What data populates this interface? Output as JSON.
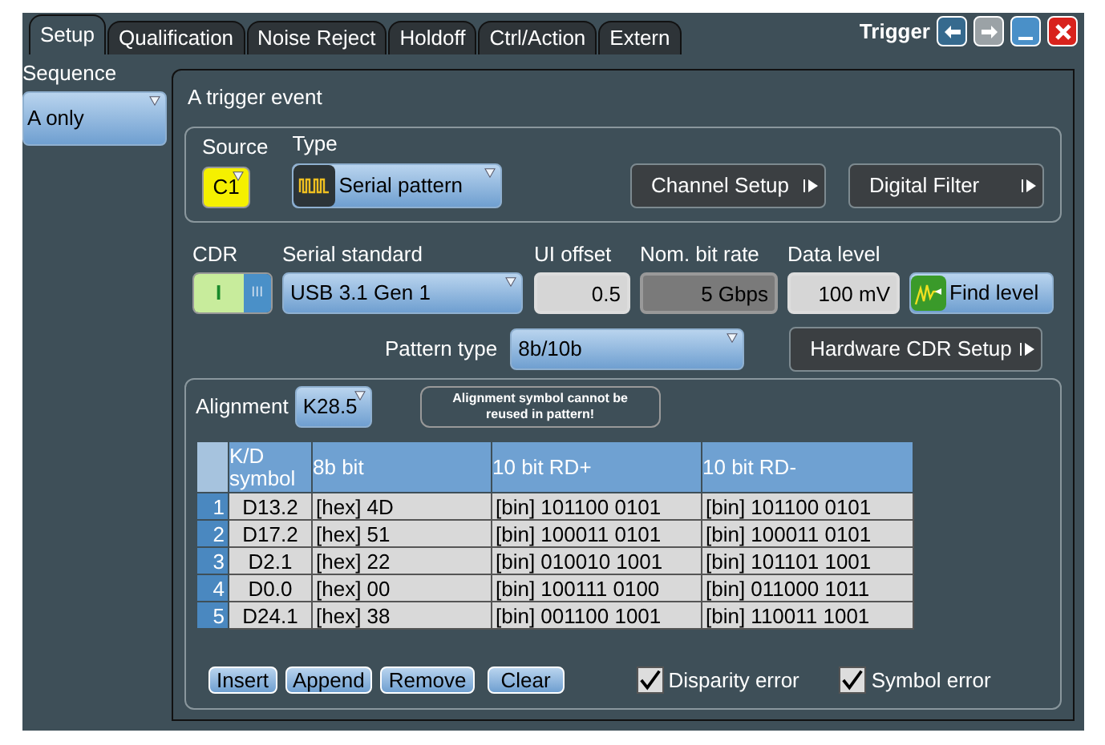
{
  "tabs": [
    {
      "label": "Setup",
      "selected": true
    },
    {
      "label": "Qualification",
      "selected": false
    },
    {
      "label": "Noise Reject",
      "selected": false
    },
    {
      "label": "Holdoff",
      "selected": false
    },
    {
      "label": "Ctrl/Action",
      "selected": false
    },
    {
      "label": "Extern",
      "selected": false
    }
  ],
  "window": {
    "title": "Trigger"
  },
  "sequence": {
    "label": "Sequence",
    "value": "A only"
  },
  "event": {
    "title": "A trigger event",
    "source_label": "Source",
    "source": "C1",
    "type_label": "Type",
    "type": "Serial pattern",
    "channel_setup": "Channel Setup",
    "digital_filter": "Digital Filter"
  },
  "cdr": {
    "label": "CDR",
    "on": true,
    "on_text": "I",
    "off_text": "III"
  },
  "serial_standard": {
    "label": "Serial standard",
    "value": "USB 3.1 Gen 1"
  },
  "ui_offset": {
    "label": "UI offset",
    "value": "0.5"
  },
  "bit_rate": {
    "label": "Nom. bit rate",
    "value": "5 Gbps",
    "disabled": true
  },
  "data_level": {
    "label": "Data level",
    "value": "100 mV"
  },
  "find_level": "Find level",
  "pattern_type": {
    "label": "Pattern type",
    "value": "8b/10b"
  },
  "hardware_cdr": "Hardware CDR Setup",
  "alignment": {
    "label": "Alignment",
    "value": "K28.5",
    "note": "Alignment symbol cannot be reused in pattern!"
  },
  "table": {
    "columns": [
      "K/D symbol",
      "8b bit",
      "10 bit RD+",
      "10 bit RD-"
    ],
    "rows": [
      {
        "index": "1",
        "cells": [
          "D13.2",
          "[hex] 4D",
          "[bin] 101100 0101",
          "[bin] 101100 0101"
        ]
      },
      {
        "index": "2",
        "cells": [
          "D17.2",
          "[hex] 51",
          "[bin] 100011 0101",
          "[bin] 100011 0101"
        ]
      },
      {
        "index": "3",
        "cells": [
          "D2.1",
          "[hex] 22",
          "[bin] 010010 1001",
          "[bin] 101101 1001"
        ]
      },
      {
        "index": "4",
        "cells": [
          "D0.0",
          "[hex] 00",
          "[bin] 100111 0100",
          "[bin] 011000 1011"
        ]
      },
      {
        "index": "5",
        "cells": [
          "D24.1",
          "[hex] 38",
          "[bin] 001100 1001",
          "[bin] 110011 1001"
        ]
      }
    ]
  },
  "buttons": [
    "Insert",
    "Append",
    "Remove",
    "Clear"
  ],
  "checks": [
    {
      "label": "Disparity error",
      "checked": true
    },
    {
      "label": "Symbol error",
      "checked": true
    }
  ]
}
